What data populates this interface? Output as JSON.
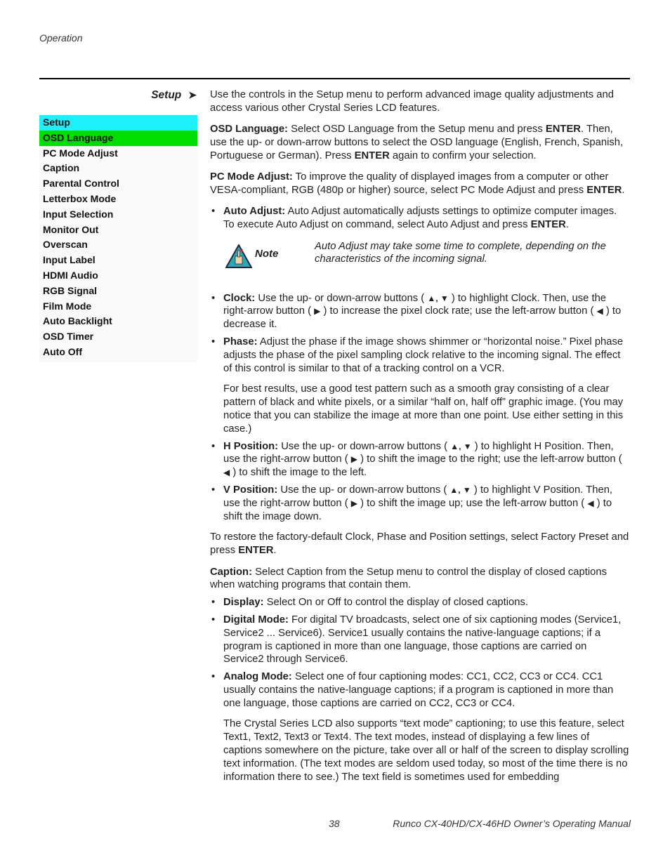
{
  "header": {
    "running_head": "Operation"
  },
  "section": {
    "title": "Setup",
    "arrow": "➤"
  },
  "menu": {
    "title": "Setup",
    "items": [
      "OSD Language",
      "PC Mode Adjust",
      "Caption",
      "Parental Control",
      "Letterbox Mode",
      "Input Selection",
      "Monitor Out",
      "Overscan",
      "Input Label",
      "HDMI Audio",
      "RGB Signal",
      "Film Mode",
      "Auto Backlight",
      "OSD Timer",
      "Auto Off"
    ],
    "selected": "OSD Language",
    "colors": {
      "title_bg": "#1cf0fb",
      "selected_bg": "#00dd00"
    }
  },
  "content": {
    "intro": "Use the controls in the Setup menu to perform advanced image quality adjustments and access various other Crystal Series LCD features.",
    "osd": {
      "label": "OSD Language:",
      "t1": " Select OSD Language from the Setup menu and press ",
      "k1": "ENTER",
      "t2": ". Then, use the up- or down-arrow buttons to select the OSD language (English, French, Spanish, Portuguese or German). Press ",
      "k2": "ENTER",
      "t3": " again to confirm your selection."
    },
    "pcmode": {
      "label": "PC Mode Adjust:",
      "t1": " To improve the quality of displayed images from a computer or other VESA-compliant, RGB (480p or higher) source, select PC Mode Adjust and press ",
      "k1": "ENTER",
      "t2": "."
    },
    "autoadjust": {
      "label": "Auto Adjust:",
      "t1": " Auto Adjust automatically adjusts settings to optimize computer images. To execute Auto Adjust on command, select Auto Adjust and press ",
      "k1": "ENTER",
      "t2": "."
    },
    "note": {
      "label": "Note",
      "text": "Auto Adjust may take some time to complete, depending on the characteristics of the incoming signal."
    },
    "clock": {
      "label": "Clock:",
      "t1": " Use the up- or down-arrow buttons ( ",
      "arrows_ud": "▲, ▼",
      "t2": " ) to highlight Clock. Then, use the right-arrow button ( ",
      "arrow_r": "▶",
      "t3": " ) to increase the pixel clock rate; use the left-arrow button ( ",
      "arrow_l": "◀",
      "t4": " ) to decrease it."
    },
    "phase": {
      "label": "Phase:",
      "t1": " Adjust the phase if the image shows shimmer or “horizontal noise.” Pixel phase adjusts the phase of the pixel sampling clock relative to the incoming signal. The effect of this control is similar to that of a tracking control on a VCR.",
      "extra": "For best results, use a good test pattern such as a smooth gray consisting of a clear pattern of black and white pixels, or a similar “half on, half off” graphic image. (You may notice that you can stabilize the image at more than one point. Use either setting in this case.)"
    },
    "hpos": {
      "label": "H Position:",
      "t1": " Use the up- or down-arrow buttons ( ",
      "arrows_ud": "▲, ▼",
      "t2": " ) to highlight H Position. Then, use the right-arrow button ( ",
      "arrow_r": "▶",
      "t3": " ) to shift the image to the right; use the left-arrow button ( ",
      "arrow_l": "◀",
      "t4": " ) to shift the image to the left."
    },
    "vpos": {
      "label": "V Position:",
      "t1": " Use the up- or down-arrow buttons ( ",
      "arrows_ud": "▲, ▼",
      "t2": " ) to highlight V Position. Then, use the right-arrow button ( ",
      "arrow_r": "▶",
      "t3": " ) to shift the image up; use the left-arrow button ( ",
      "arrow_l": "◀",
      "t4": " ) to shift the image down."
    },
    "restore": {
      "t1": "To restore the factory-default Clock, Phase and Position settings, select Factory Preset and press ",
      "k1": "ENTER",
      "t2": "."
    },
    "caption": {
      "label": "Caption:",
      "t1": " Select Caption from the Setup menu to control the display of closed captions when watching programs that contain them."
    },
    "display": {
      "label": "Display:",
      "t1": " Select On or Off to control the display of closed captions."
    },
    "digital": {
      "label": "Digital Mode:",
      "t1": " For digital TV broadcasts, select one of six captioning modes (Service1, Service2 ... Service6). Service1 usually contains the native-language captions; if a program is captioned in more than one language, those captions are carried on Service2 through Service6."
    },
    "analog": {
      "label": "Analog Mode:",
      "t1": " Select one of four captioning modes: CC1, CC2, CC3 or CC4. CC1 usually contains the native-language captions; if a program is captioned in more than one language, those captions are carried on CC2, CC3 or CC4.",
      "extra": "The Crystal Series LCD also supports “text mode” captioning; to use this feature, select Text1, Text2, Text3 or Text4. The text modes, instead of displaying a few lines of captions somewhere on the picture, take over all or half of the screen to display scrolling text information. (The text modes are seldom used today, so most of the time there is no information there to see.) The text field is sometimes used for embedding"
    }
  },
  "footer": {
    "page_number": "38",
    "manual_title": "Runco CX-40HD/CX-46HD Owner’s Operating Manual"
  }
}
